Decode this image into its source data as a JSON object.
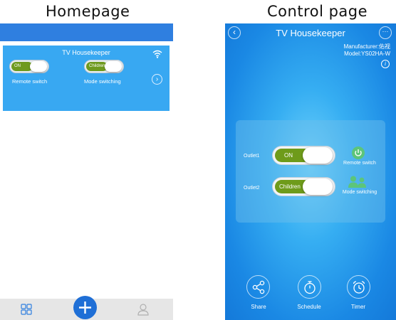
{
  "captions": {
    "left": "Homepage",
    "right": "Control page"
  },
  "homepage": {
    "card": {
      "title": "TV Housekeeper",
      "toggle1_value": "ON",
      "toggle1_label": "Remote switch",
      "toggle2_value": "Children",
      "toggle2_label": "Mode switching",
      "arrow_icon": "chevron-right-icon",
      "status_icon": "wifi-icon"
    },
    "tabbar": {
      "icons": [
        "grid-icon",
        "add-icon",
        "user-icon"
      ]
    }
  },
  "control": {
    "title": "TV Housekeeper",
    "manufacturer": "Manufacturer:佑视",
    "model": "Model:YS02HA-W",
    "outlets": [
      {
        "label": "Outlet1",
        "value": "ON",
        "action": "Remote switch",
        "icon": "power-icon"
      },
      {
        "label": "Outlet2",
        "value": "Children",
        "action": "Mode switching",
        "icon": "people-icon"
      }
    ],
    "buttons": [
      {
        "label": "Share",
        "icon": "share-icon"
      },
      {
        "label": "Schedule",
        "icon": "stopwatch-icon"
      },
      {
        "label": "Timer",
        "icon": "alarm-clock-icon"
      }
    ]
  },
  "colors": {
    "header_blue": "#2f7fe0",
    "card_blue": "#38a8f2",
    "toggle_green": "#6e9b1a",
    "accent_green": "#5cc57a",
    "fab_blue": "#1f6fd6"
  }
}
